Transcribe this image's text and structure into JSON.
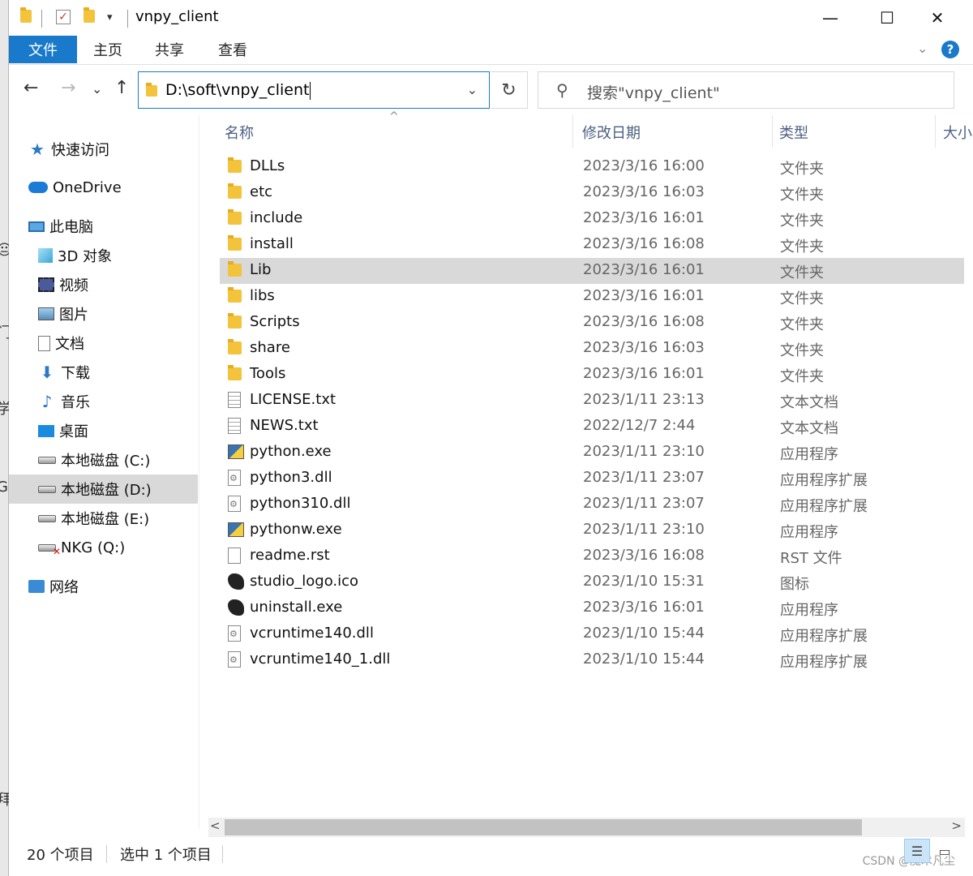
{
  "window": {
    "title": "vnpy_client",
    "controls": {
      "minimize": "—",
      "maximize": "☐",
      "close": "✕"
    }
  },
  "ribbon": {
    "tabs": [
      "文件",
      "主页",
      "共享",
      "查看"
    ],
    "help_label": "?"
  },
  "nav": {
    "back": "←",
    "forward": "→",
    "recent": "⌄",
    "up": "↑",
    "address": "D:\\soft\\vnpy_client",
    "refresh": "↻",
    "search_placeholder": "搜索\"vnpy_client\""
  },
  "sidebar": {
    "items": [
      {
        "label": "快速访问",
        "icon": "star-icon"
      },
      {
        "label": "OneDrive",
        "icon": "cloud-icon"
      },
      {
        "label": "此电脑",
        "icon": "computer-icon"
      },
      {
        "label": "3D 对象",
        "icon": "cube-icon"
      },
      {
        "label": "视频",
        "icon": "video-icon"
      },
      {
        "label": "图片",
        "icon": "picture-icon"
      },
      {
        "label": "文档",
        "icon": "document-icon"
      },
      {
        "label": "下载",
        "icon": "download-icon"
      },
      {
        "label": "音乐",
        "icon": "music-icon"
      },
      {
        "label": "桌面",
        "icon": "desktop-icon"
      },
      {
        "label": "本地磁盘 (C:)",
        "icon": "drive-icon"
      },
      {
        "label": "本地磁盘 (D:)",
        "icon": "drive-icon",
        "selected": true
      },
      {
        "label": "本地磁盘 (E:)",
        "icon": "drive-icon"
      },
      {
        "label": "NKG (Q:)",
        "icon": "network-drive-disconnected-icon"
      },
      {
        "label": "网络",
        "icon": "network-icon"
      }
    ]
  },
  "columns": {
    "name": "名称",
    "date": "修改日期",
    "type": "类型",
    "size": "大小"
  },
  "files": [
    {
      "name": "DLLs",
      "date": "2023/3/16 16:00",
      "type": "文件夹",
      "icon": "folder-icon"
    },
    {
      "name": "etc",
      "date": "2023/3/16 16:03",
      "type": "文件夹",
      "icon": "folder-icon"
    },
    {
      "name": "include",
      "date": "2023/3/16 16:01",
      "type": "文件夹",
      "icon": "folder-icon"
    },
    {
      "name": "install",
      "date": "2023/3/16 16:08",
      "type": "文件夹",
      "icon": "folder-icon"
    },
    {
      "name": "Lib",
      "date": "2023/3/16 16:01",
      "type": "文件夹",
      "icon": "folder-icon",
      "selected": true
    },
    {
      "name": "libs",
      "date": "2023/3/16 16:01",
      "type": "文件夹",
      "icon": "folder-icon"
    },
    {
      "name": "Scripts",
      "date": "2023/3/16 16:08",
      "type": "文件夹",
      "icon": "folder-icon"
    },
    {
      "name": "share",
      "date": "2023/3/16 16:03",
      "type": "文件夹",
      "icon": "folder-icon"
    },
    {
      "name": "Tools",
      "date": "2023/3/16 16:01",
      "type": "文件夹",
      "icon": "folder-icon"
    },
    {
      "name": "LICENSE.txt",
      "date": "2023/1/11 23:13",
      "type": "文本文档",
      "icon": "text-file-icon"
    },
    {
      "name": "NEWS.txt",
      "date": "2022/12/7 2:44",
      "type": "文本文档",
      "icon": "text-file-icon"
    },
    {
      "name": "python.exe",
      "date": "2023/1/11 23:10",
      "type": "应用程序",
      "icon": "python-icon"
    },
    {
      "name": "python3.dll",
      "date": "2023/1/11 23:07",
      "type": "应用程序扩展",
      "icon": "dll-file-icon"
    },
    {
      "name": "python310.dll",
      "date": "2023/1/11 23:07",
      "type": "应用程序扩展",
      "icon": "dll-file-icon"
    },
    {
      "name": "pythonw.exe",
      "date": "2023/1/11 23:10",
      "type": "应用程序",
      "icon": "python-icon"
    },
    {
      "name": "readme.rst",
      "date": "2023/3/16 16:08",
      "type": "RST 文件",
      "icon": "blank-file-icon"
    },
    {
      "name": "studio_logo.ico",
      "date": "2023/1/10 15:31",
      "type": "图标",
      "icon": "logo-icon"
    },
    {
      "name": "uninstall.exe",
      "date": "2023/3/16 16:01",
      "type": "应用程序",
      "icon": "logo-icon"
    },
    {
      "name": "vcruntime140.dll",
      "date": "2023/1/10 15:44",
      "type": "应用程序扩展",
      "icon": "dll-file-icon"
    },
    {
      "name": "vcruntime140_1.dll",
      "date": "2023/1/10 15:44",
      "type": "应用程序扩展",
      "icon": "dll-file-icon"
    }
  ],
  "status": {
    "count": "20 个项目",
    "selected": "选中 1 个项目"
  },
  "watermark": "CSDN @魔术凡尘",
  "colors": {
    "accent": "#1979ca",
    "selection": "#d9d9d9",
    "folder": "#f3c33b"
  }
}
